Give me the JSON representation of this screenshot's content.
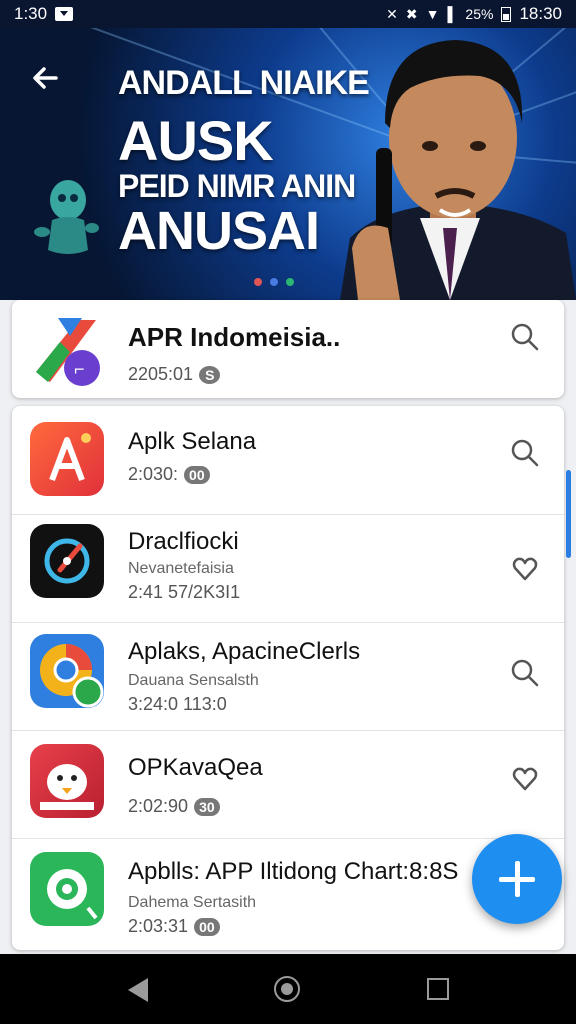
{
  "status_bar": {
    "time_left": "1:30",
    "battery_text": "25%",
    "time_right": "18:30"
  },
  "banner": {
    "lines": [
      "ANDALL NIAIKE",
      "AUSK",
      "PEID NIMR ANIN",
      "ANUSAI"
    ],
    "dot_colors": [
      "#e25555",
      "#4a7be0",
      "#2bb673"
    ]
  },
  "featured": {
    "title": "APR Indomeisia..",
    "meta": "2205:01",
    "badge": "S",
    "action_icon": "search-icon"
  },
  "apps": [
    {
      "title": "Aplk Selana",
      "subtitle": "",
      "meta": "2:030:",
      "badge": "00",
      "action_icon": "search-icon"
    },
    {
      "title": "Draclfiocki",
      "subtitle": "Nevanetefaisia",
      "meta": "2:41 57/2K3I1",
      "badge": "",
      "action_icon": "heart-icon"
    },
    {
      "title": "Aplaks, ApacineClerls",
      "subtitle": "Dauana Sensalsth",
      "meta": "3:24:0 113:0",
      "badge": "",
      "action_icon": "search-icon"
    },
    {
      "title": "OPKavaQea",
      "subtitle": "",
      "meta": "2:02:90",
      "badge": "30",
      "action_icon": "heart-icon"
    },
    {
      "title": "Apblls: APP Iltidong Chart:8:8S",
      "subtitle": "Dahema Sertasith",
      "meta": "2:03:31",
      "badge": "00",
      "action_icon": ""
    }
  ],
  "colors": {
    "accent": "#1f8ef1",
    "status_bar": "#0a1530",
    "nav_bar": "#000000"
  }
}
